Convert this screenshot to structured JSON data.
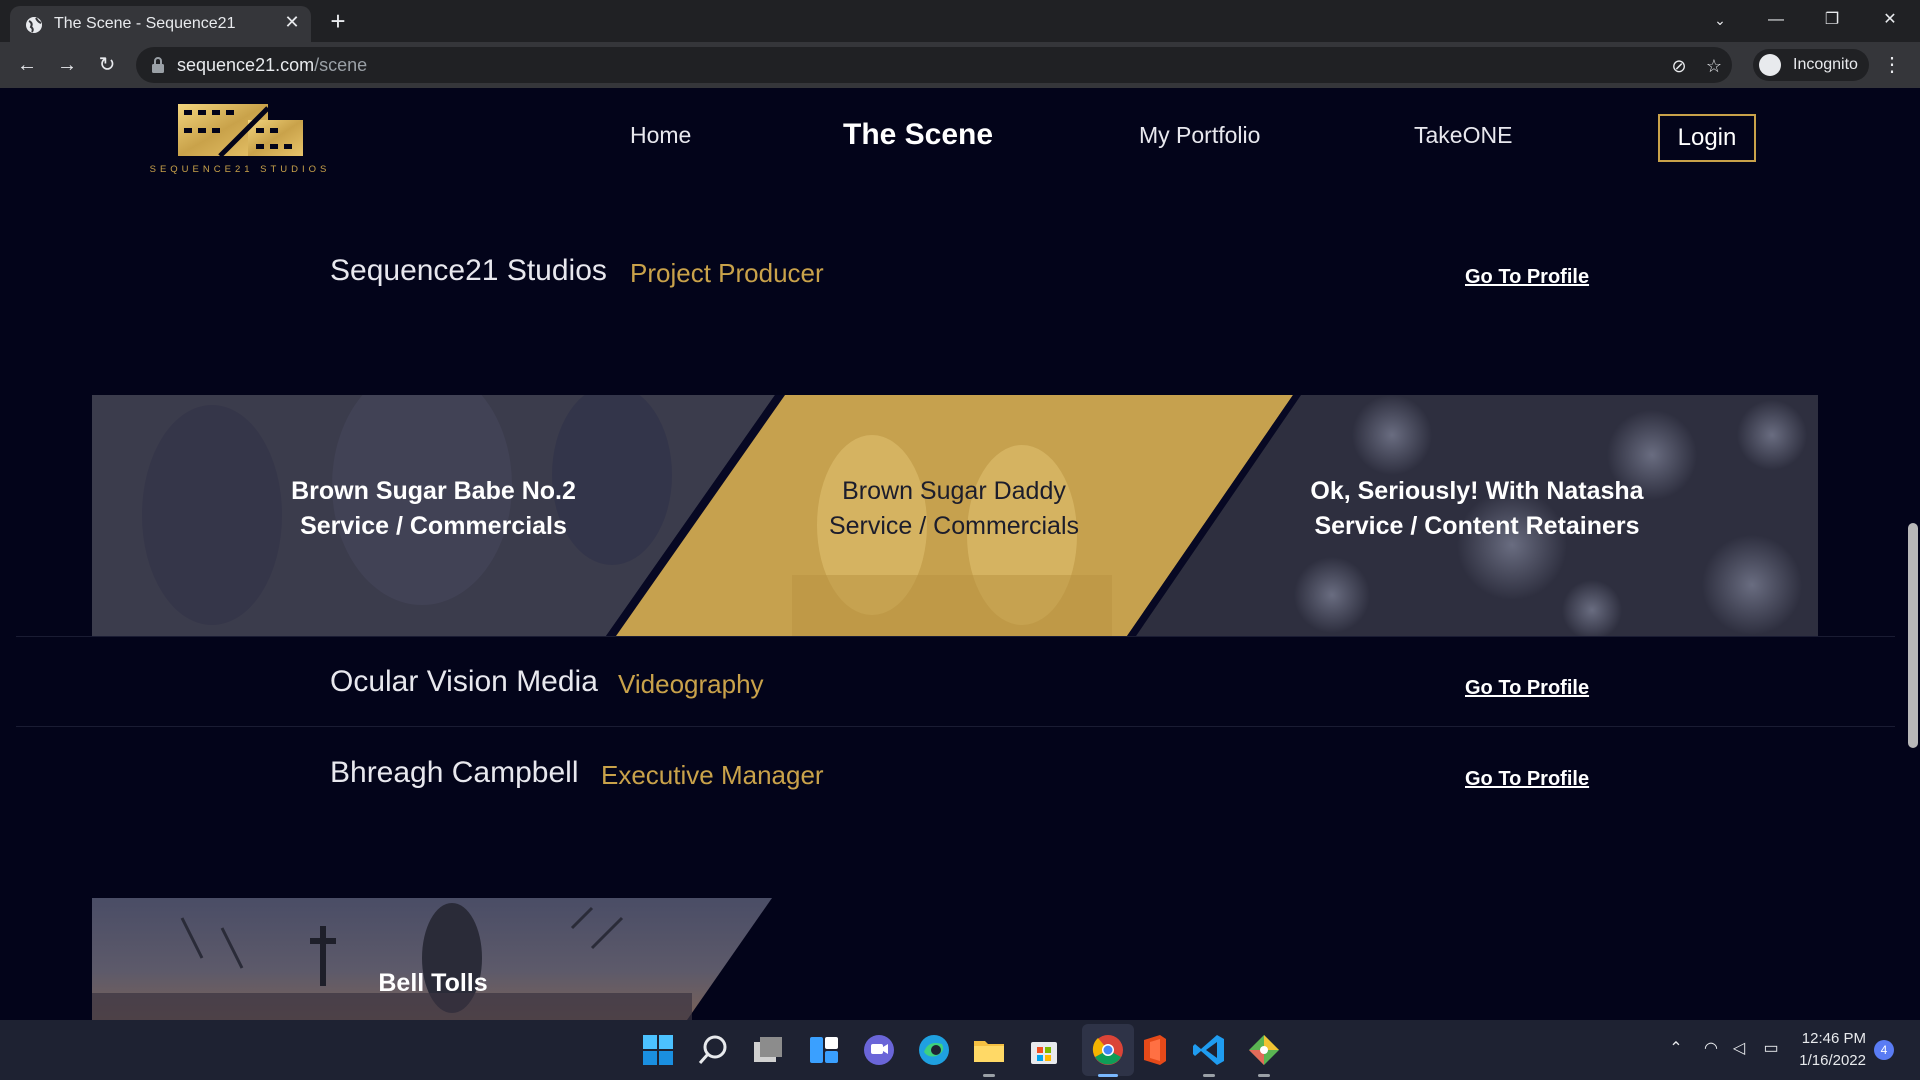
{
  "browser": {
    "tab_title": "The Scene - Sequence21",
    "tab_close": "✕",
    "new_tab": "+",
    "url_domain": "sequence21.com",
    "url_path": "/scene",
    "profile_label": "Incognito"
  },
  "site": {
    "logo_text": "SEQUENCE21 STUDIOS",
    "nav": {
      "home": "Home",
      "scene": "The Scene",
      "portfolio": "My Portfolio",
      "takeone": "TakeONE",
      "login": "Login"
    },
    "accent_color": "#c9a24a",
    "background_color": "#03041a"
  },
  "members": [
    {
      "name": "Sequence21 Studios",
      "role": "Project Producer",
      "link": "Go To Profile"
    },
    {
      "name": "Ocular Vision Media",
      "role": "Videography",
      "link": "Go To Profile"
    },
    {
      "name": "Bhreagh Campbell",
      "role": "Executive Manager",
      "link": "Go To Profile"
    }
  ],
  "projects": [
    {
      "title": "Brown Sugar Babe No.2",
      "subtitle": "Service / Commercials"
    },
    {
      "title": "Brown Sugar Daddy",
      "subtitle": "Service / Commercials"
    },
    {
      "title": "Ok, Seriously! With Natasha",
      "subtitle": "Service / Content Retainers"
    },
    {
      "title": "Bell Tolls"
    }
  ],
  "taskbar": {
    "time": "12:46 PM",
    "date": "1/16/2022",
    "notifications": "4"
  }
}
